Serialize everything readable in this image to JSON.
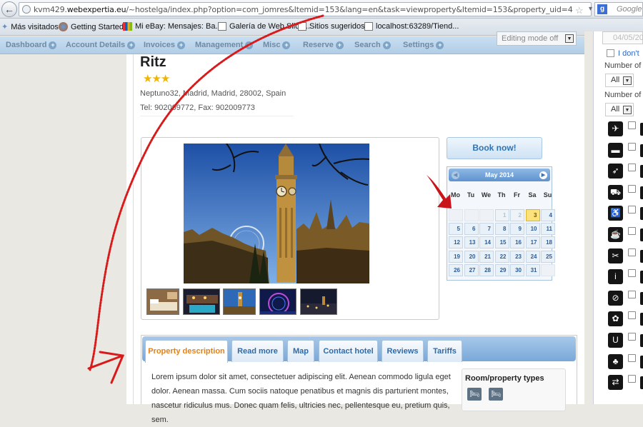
{
  "browser": {
    "url_prefix": "kvm429.",
    "url_domain": "webexpertia.eu",
    "url_suffix": "/~hostelga/index.php?option=com_jomres&Itemid=153&lang=en&task=viewproperty&Itemid=153&property_uid=4",
    "search_engine": "Google",
    "search_placeholder": "Google"
  },
  "bookmarks": [
    {
      "label": "Más visitados",
      "icon": "star-icon"
    },
    {
      "label": "Getting Started",
      "icon": "firefox-icon"
    },
    {
      "label": "Mi eBay: Mensajes: Ba...",
      "icon": "ebay-icon"
    },
    {
      "label": "Galería de Web Slice...",
      "icon": "page-icon"
    },
    {
      "label": "Sitios sugeridos",
      "icon": "page-icon"
    },
    {
      "label": "localhost:63289/Tiend...",
      "icon": "page-icon"
    }
  ],
  "admin_menu": [
    {
      "label": "Dashboard"
    },
    {
      "label": "Account Details"
    },
    {
      "label": "Invoices"
    },
    {
      "label": "Management"
    },
    {
      "label": "Misc"
    },
    {
      "label": "Reserve"
    },
    {
      "label": "Search"
    },
    {
      "label": "Settings"
    }
  ],
  "editing_mode": "Editing mode off",
  "property": {
    "name": "Ritz",
    "stars": 3,
    "stars_text": "★★★",
    "address": "Neptuno32, Madrid, Madrid, 28002, Spain",
    "phones": "Tel: 902009772, Fax: 902009773"
  },
  "booking": {
    "book_now": "Book now!"
  },
  "calendar": {
    "month": "May 2014",
    "weekdays": [
      "Mo",
      "Tu",
      "We",
      "Th",
      "Fr",
      "Sa",
      "Su"
    ],
    "today": 3
  },
  "tabs": [
    {
      "label": "Property description",
      "active": true
    },
    {
      "label": "Read more",
      "active": false
    },
    {
      "label": "Map",
      "active": false
    },
    {
      "label": "Contact hotel",
      "active": false
    },
    {
      "label": "Reviews",
      "active": false
    },
    {
      "label": "Tariffs",
      "active": false
    }
  ],
  "description": "Lorem ipsum dolor sit amet, consectetuer adipiscing elit. Aenean commodo ligula eget dolor. Aenean massa. Cum sociis natoque penatibus et magnis dis parturient montes, nascetur ridiculus mus. Donec quam felis, ultricies nec, pellentesque eu, pretium quis, sem.",
  "room_types": {
    "title": "Room/property types"
  },
  "search_panel": {
    "date": "04/05/20",
    "dont_know": "I don't",
    "number_label_1": "Number of",
    "number_label_2": "Number of",
    "select_1": "All",
    "select_2": "All",
    "features": [
      "airport-icon",
      "bath-icon",
      "hairdryer-icon",
      "car-icon",
      "disabled-access-icon",
      "breakfast-icon",
      "scissors-icon",
      "information-icon",
      "no-smoking-icon",
      "laundry-icon",
      "horseshoe-icon",
      "cocktail-icon",
      "shuttle-icon"
    ]
  },
  "colors": {
    "menu_bar": "#b8d2ea",
    "active_tab_text": "#e0821c",
    "link_blue": "#2f6aa8",
    "today_highlight": "#fbe27a",
    "annotation": "#d81a1a"
  }
}
